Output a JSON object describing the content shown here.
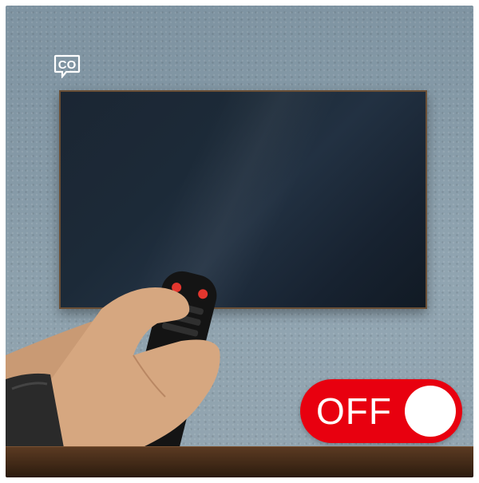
{
  "logo": {
    "text": "CO",
    "icon": "speech-bubble-icon"
  },
  "toggle": {
    "label": "OFF",
    "state": "off",
    "color": "#e8000f"
  },
  "colors": {
    "wall": "#8ea2ae",
    "tv_screen": "#1c2a38",
    "tv_frame": "#6a4f36",
    "floor": "#3f2816"
  }
}
